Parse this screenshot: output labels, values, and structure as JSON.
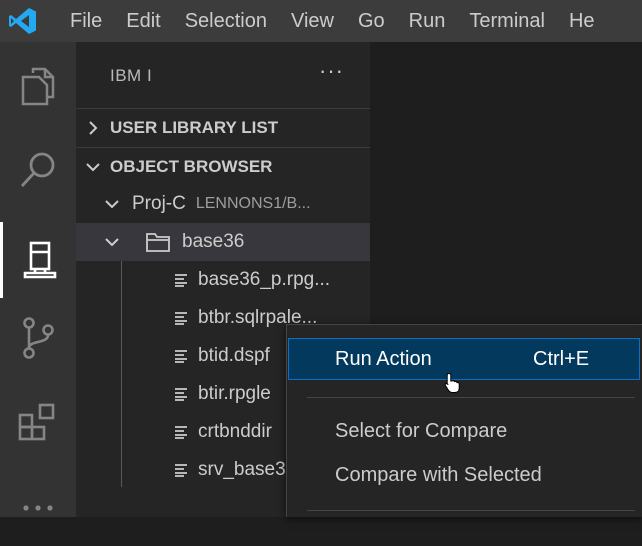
{
  "menubar": {
    "items": [
      "File",
      "Edit",
      "Selection",
      "View",
      "Go",
      "Run",
      "Terminal",
      "He"
    ]
  },
  "activitybar": {
    "icons": [
      "explorer-icon",
      "search-icon",
      "ibmi-icon",
      "source-control-icon",
      "extensions-icon",
      "more-icon"
    ]
  },
  "sidebar": {
    "title": "IBM I",
    "more": "···",
    "sections": [
      {
        "label": "USER LIBRARY LIST",
        "expanded": false
      },
      {
        "label": "OBJECT BROWSER",
        "expanded": true
      }
    ],
    "filter": {
      "label": "Proj-C",
      "description": "LENNONS1/B..."
    },
    "folder": {
      "label": "base36"
    },
    "files": [
      "base36_p.rpg...",
      "btbr.sqlrpale...",
      "btid.dspf",
      "btir.rpgle",
      "crtbnddir",
      "srv_base3"
    ]
  },
  "context_menu": {
    "items": [
      {
        "label": "Run Action",
        "shortcut": "Ctrl+E"
      },
      {
        "label": "Select for Compare"
      },
      {
        "label": "Compare with Selected"
      }
    ]
  },
  "colors": {
    "titlebar": "#3c3c3c",
    "activitybar": "#333333",
    "sidebar": "#252526",
    "editor": "#1e1e1e",
    "menu_highlight": "#04395e",
    "logo_blue": "#23a9f2"
  }
}
